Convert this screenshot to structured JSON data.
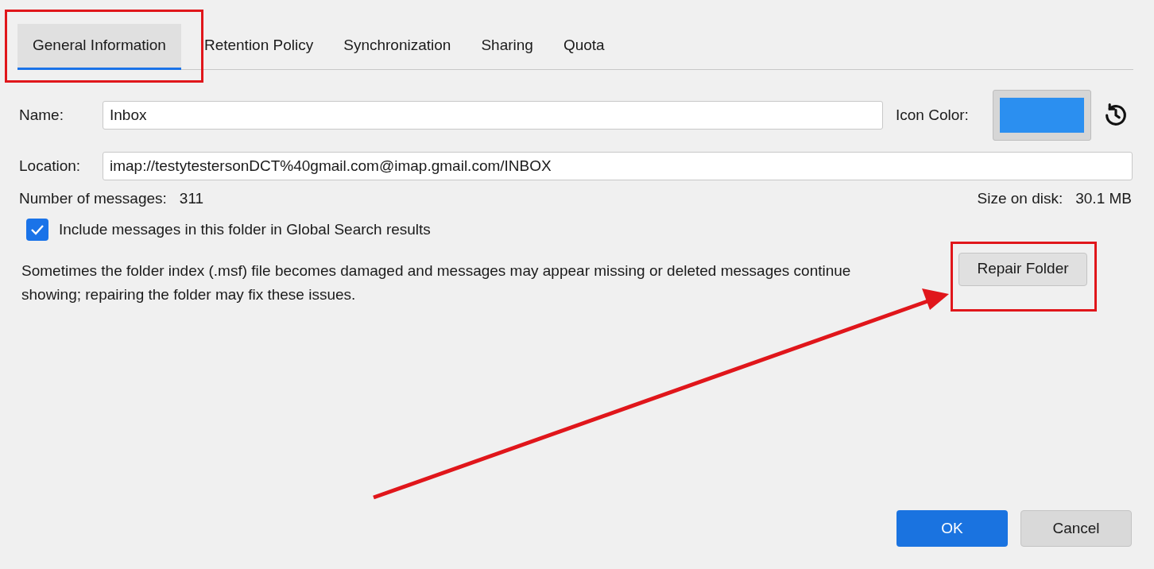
{
  "tabs": [
    {
      "label": "General Information",
      "selected": true
    },
    {
      "label": "Retention Policy",
      "selected": false
    },
    {
      "label": "Synchronization",
      "selected": false
    },
    {
      "label": "Sharing",
      "selected": false
    },
    {
      "label": "Quota",
      "selected": false
    }
  ],
  "name": {
    "label": "Name:",
    "value": "Inbox"
  },
  "icon_color": {
    "label": "Icon Color:",
    "color": "#2b8ff0"
  },
  "location": {
    "label": "Location:",
    "value": "imap://testytestersonDCT%40gmail.com@imap.gmail.com/INBOX"
  },
  "messages": {
    "label": "Number of messages:",
    "value": "311"
  },
  "size": {
    "label": "Size on disk:",
    "value": "30.1 MB"
  },
  "global_search": {
    "label": "Include messages in this folder in Global Search results",
    "checked": true
  },
  "repair": {
    "text": "Sometimes the folder index (.msf) file becomes damaged and messages may appear missing or deleted messages continue showing; repairing the folder may fix these issues.",
    "button": "Repair Folder"
  },
  "buttons": [
    {
      "label": "OK",
      "kind": "primary"
    },
    {
      "label": "Cancel",
      "kind": "secondary"
    }
  ]
}
